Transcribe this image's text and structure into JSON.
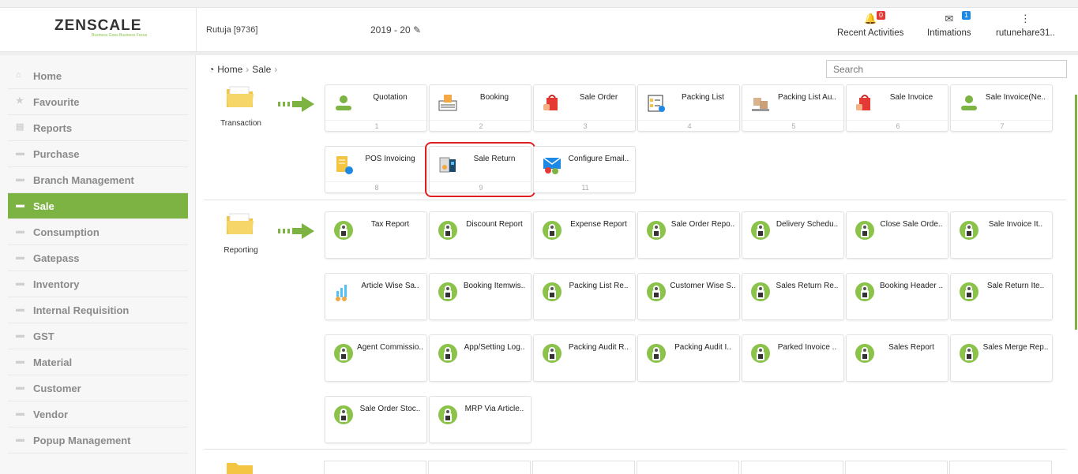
{
  "header": {
    "brand": "ZENSCALE",
    "brand_tagline": "Business Goes Business Focus",
    "user": "Rutuja [9736]",
    "year": "2019 - 20",
    "recent_activities": {
      "label": "Recent Activities",
      "badge": "0",
      "badge_color": "#e53935"
    },
    "intimations": {
      "label": "Intimations",
      "badge": "1",
      "badge_color": "#1e88e5"
    },
    "account": "rutunehare31.."
  },
  "sidebar": {
    "active_color": "#7cb342",
    "items": [
      {
        "label": "Home",
        "icon": "home-icon"
      },
      {
        "label": "Favourite",
        "icon": "star-icon"
      },
      {
        "label": "Reports",
        "icon": "file-icon"
      },
      {
        "label": "Purchase",
        "icon": "folder-icon"
      },
      {
        "label": "Branch Management",
        "icon": "folder-icon"
      },
      {
        "label": "Sale",
        "icon": "folder-icon",
        "active": true
      },
      {
        "label": "Consumption",
        "icon": "folder-icon"
      },
      {
        "label": "Gatepass",
        "icon": "folder-icon"
      },
      {
        "label": "Inventory",
        "icon": "folder-icon"
      },
      {
        "label": "Internal Requisition",
        "icon": "folder-icon"
      },
      {
        "label": "GST",
        "icon": "folder-icon"
      },
      {
        "label": "Material",
        "icon": "folder-icon"
      },
      {
        "label": "Customer",
        "icon": "folder-icon"
      },
      {
        "label": "Vendor",
        "icon": "folder-icon"
      },
      {
        "label": "Popup Management",
        "icon": "folder-icon"
      }
    ]
  },
  "breadcrumb": {
    "home": "Home",
    "current": "Sale"
  },
  "search": {
    "placeholder": "Search"
  },
  "sections": {
    "transaction": {
      "label": "Transaction",
      "cards": [
        {
          "label": "Quotation",
          "num": "1",
          "icon": "person-icon"
        },
        {
          "label": "Booking",
          "num": "2",
          "icon": "booking-icon"
        },
        {
          "label": "Sale Order",
          "num": "3",
          "icon": "bag-icon"
        },
        {
          "label": "Packing List",
          "num": "4",
          "icon": "checklist-icon"
        },
        {
          "label": "Packing List Au..",
          "num": "5",
          "icon": "boxes-icon"
        },
        {
          "label": "Sale Invoice",
          "num": "6",
          "icon": "bag-icon"
        },
        {
          "label": "Sale Invoice(Ne..",
          "num": "7",
          "icon": "person-icon"
        },
        {
          "label": "POS Invoicing",
          "num": "8",
          "icon": "pos-icon"
        },
        {
          "label": "Sale Return",
          "num": "9",
          "icon": "return-icon",
          "highlight": true
        },
        {
          "label": "Configure Email..",
          "num": "11",
          "icon": "email-gear-icon"
        }
      ]
    },
    "reporting": {
      "label": "Reporting",
      "cards": [
        {
          "label": "Tax Report"
        },
        {
          "label": "Discount Report"
        },
        {
          "label": "Expense Report"
        },
        {
          "label": "Sale Order Repo.."
        },
        {
          "label": "Delivery Schedu.."
        },
        {
          "label": "Close Sale Orde.."
        },
        {
          "label": "Sale Invoice It.."
        },
        {
          "label": "Article Wise Sa..",
          "icon": "chart-gear-icon"
        },
        {
          "label": "Booking Itemwis.."
        },
        {
          "label": "Packing List Re.."
        },
        {
          "label": "Customer Wise S.."
        },
        {
          "label": "Sales Return Re.."
        },
        {
          "label": "Booking Header .."
        },
        {
          "label": "Sale Return Ite.."
        },
        {
          "label": "Agent Commissio.."
        },
        {
          "label": "App/Setting Log.."
        },
        {
          "label": "Packing Audit R.."
        },
        {
          "label": "Packing Audit I.."
        },
        {
          "label": "Parked Invoice .."
        },
        {
          "label": "Sales Report"
        },
        {
          "label": "Sales Merge Rep.."
        },
        {
          "label": "Sale Order Stoc.."
        },
        {
          "label": "MRP Via Article.."
        }
      ]
    }
  }
}
